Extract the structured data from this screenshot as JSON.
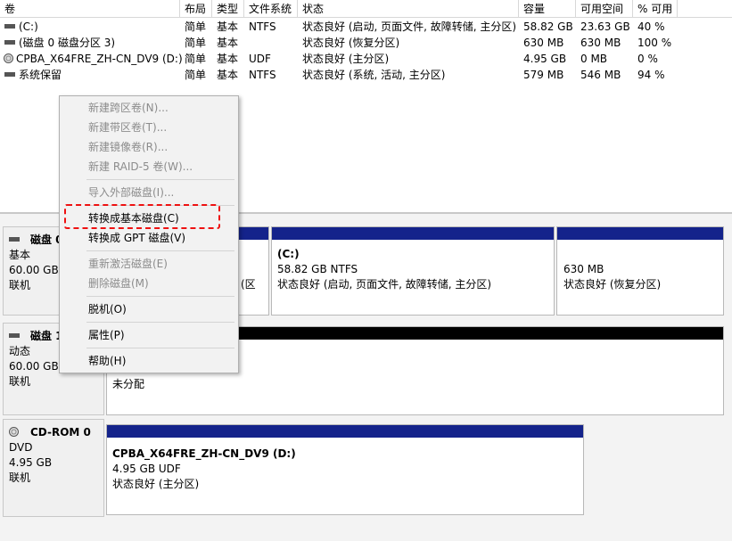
{
  "columns": [
    "卷",
    "布局",
    "类型",
    "文件系统",
    "状态",
    "容量",
    "可用空间",
    "% 可用"
  ],
  "volumes": [
    {
      "name": "(C:)",
      "icon": "disk-icon",
      "layout": "简单",
      "type": "基本",
      "fs": "NTFS",
      "status": "状态良好 (启动, 页面文件, 故障转储, 主分区)",
      "capacity": "58.82 GB",
      "free": "23.63 GB",
      "pct": "40 %"
    },
    {
      "name": "(磁盘 0 磁盘分区 3)",
      "icon": "disk-icon",
      "layout": "简单",
      "type": "基本",
      "fs": "",
      "status": "状态良好 (恢复分区)",
      "capacity": "630 MB",
      "free": "630 MB",
      "pct": "100 %"
    },
    {
      "name": "CPBA_X64FRE_ZH-CN_DV9 (D:)",
      "icon": "dvd-icon",
      "layout": "简单",
      "type": "基本",
      "fs": "UDF",
      "status": "状态良好 (主分区)",
      "capacity": "4.95 GB",
      "free": "0 MB",
      "pct": "0 %"
    },
    {
      "name": "系统保留",
      "icon": "disk-icon",
      "layout": "简单",
      "type": "基本",
      "fs": "NTFS",
      "status": "状态良好 (系统, 活动, 主分区)",
      "capacity": "579 MB",
      "free": "546 MB",
      "pct": "94 %"
    }
  ],
  "disks": [
    {
      "title": "磁盘 0",
      "kind": "基本",
      "size": "60.00 GB",
      "state": "联机"
    },
    {
      "title": "磁盘 1",
      "kind": "动态",
      "size": "60.00 GB",
      "state": "联机"
    },
    {
      "title": "CD-ROM 0",
      "kind": "DVD",
      "size": "4.95 GB",
      "state": "联机"
    }
  ],
  "partitions": {
    "disk0_hidden_status": "(区",
    "disk0_c": {
      "name": "(C:)",
      "size": "58.82 GB NTFS",
      "status": "状态良好 (启动, 页面文件, 故障转储, 主分区)"
    },
    "disk0_recovery": {
      "size": "630 MB",
      "status": "状态良好 (恢复分区)"
    },
    "disk1_unallocated": "未分配",
    "cdrom": {
      "name": "CPBA_X64FRE_ZH-CN_DV9  (D:)",
      "size": "4.95 GB UDF",
      "status": "状态良好 (主分区)"
    }
  },
  "context_menu": {
    "items": [
      {
        "label": "新建跨区卷(N)...",
        "enabled": false
      },
      {
        "label": "新建带区卷(T)...",
        "enabled": false
      },
      {
        "label": "新建镜像卷(R)...",
        "enabled": false
      },
      {
        "label": "新建 RAID-5 卷(W)...",
        "enabled": false
      },
      {
        "label": "导入外部磁盘(I)...",
        "enabled": false
      },
      {
        "label": "转换成基本磁盘(C)",
        "enabled": true,
        "highlighted": true
      },
      {
        "label": "转换成 GPT 磁盘(V)",
        "enabled": true
      },
      {
        "label": "重新激活磁盘(E)",
        "enabled": false
      },
      {
        "label": "删除磁盘(M)",
        "enabled": false
      },
      {
        "label": "脱机(O)",
        "enabled": true
      },
      {
        "label": "属性(P)",
        "enabled": true
      },
      {
        "label": "帮助(H)",
        "enabled": true
      }
    ]
  },
  "colors": {
    "primary_partition_bar": "#14238b",
    "unallocated_bar": "#000000",
    "highlight_box": "#ee1111"
  }
}
